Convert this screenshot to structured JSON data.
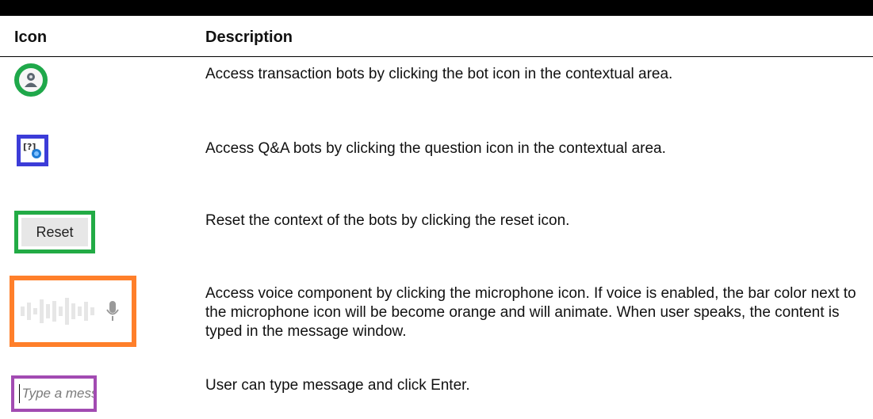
{
  "table": {
    "headers": {
      "icon": "Icon",
      "description": "Description"
    },
    "rows": [
      {
        "icon": "bot-icon",
        "description": "Access transaction bots by clicking the bot icon in the contextual area."
      },
      {
        "icon": "question-icon",
        "description": "Access Q&A bots by clicking the question icon in the contextual area."
      },
      {
        "icon": "reset-button",
        "icon_label": "Reset",
        "description": "Reset the context of the bots by clicking the reset icon."
      },
      {
        "icon": "microphone-icon",
        "description": "Access voice component by clicking the microphone icon. If voice is enabled, the bar color next to the microphone icon will be become orange and will animate. When user speaks, the content is typed in the message window."
      },
      {
        "icon": "message-input",
        "icon_placeholder": "Type a message",
        "description": "User can type message and click Enter."
      }
    ]
  },
  "colors": {
    "bot_ring": "#1fa84a",
    "question_frame": "#3c3cd8",
    "reset_frame": "#22ab45",
    "voice_frame": "#ff7f2a",
    "message_frame": "#a24bb2"
  }
}
